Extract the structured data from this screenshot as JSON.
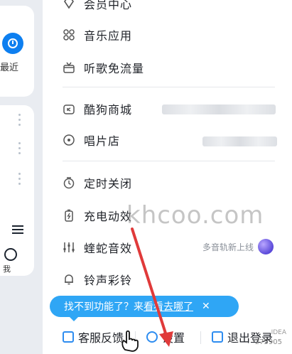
{
  "left_panel": {
    "recent_label": "最近",
    "me_label": "我"
  },
  "menu": {
    "items": [
      {
        "label": "会员中心",
        "icon": "diamond-icon"
      },
      {
        "label": "音乐应用",
        "icon": "apps-grid-icon"
      },
      {
        "label": "听歌免流量",
        "icon": "gift-icon"
      },
      {
        "label": "酷狗商城",
        "icon": "shop-bag-icon"
      },
      {
        "label": "唱片店",
        "icon": "disc-icon"
      },
      {
        "label": "定时关闭",
        "icon": "timer-icon"
      },
      {
        "label": "充电动效",
        "icon": "battery-icon"
      },
      {
        "label": "蝰蛇音效",
        "icon": "equalizer-icon"
      },
      {
        "label": "铃声彩铃",
        "icon": "bell-icon"
      }
    ],
    "sound_effect_note": "多音轨新上线"
  },
  "tooltip": {
    "text": "找不到功能了？来",
    "link": "看看去哪了",
    "close": "✕"
  },
  "bottom_bar": {
    "feedback_label": "客服反馈",
    "settings_label": "设置",
    "exit_label": "退出登录"
  },
  "watermark": {
    "text": "khcoo.com",
    "corner_top": "IDEA",
    "corner_bottom": "275905"
  },
  "colors": {
    "accent": "#2d8cf0",
    "tooltip": "#2fa6f5",
    "arrow": "#e03a3a"
  }
}
